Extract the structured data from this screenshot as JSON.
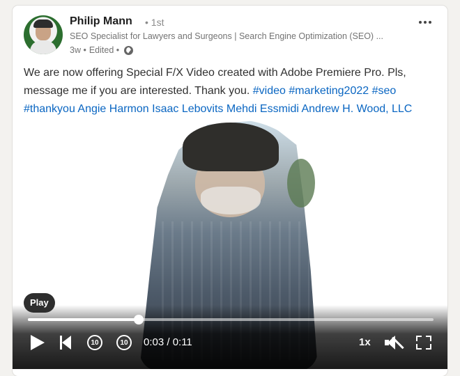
{
  "author": {
    "name": "Philip Mann",
    "degree": "• 1st",
    "headline": "SEO Specialist for Lawyers and Surgeons | Search Engine Optimization (SEO) ...",
    "time": "3w •",
    "edited": "Edited •",
    "avatar_icon": "profile-photo",
    "visibility_icon": "globe-icon"
  },
  "post": {
    "text_intro": "We are now offering Special F/X Video created with Adobe Premiere Pro. Pls, message me if you are interested. Thank you.",
    "hashtags": [
      "#video",
      "#marketing2022",
      "#seo",
      "#thankyou"
    ],
    "mentions": [
      "Angie Harmon",
      "Isaac Lebovits",
      "Mehdi Essmidi",
      "Andrew H. Wood, LLC"
    ]
  },
  "video": {
    "tooltip": "Play",
    "current_time": "0:03",
    "separator": "/",
    "duration": "0:11",
    "time_display": "0:03 / 0:11",
    "progress_fraction": 0.273,
    "speed": "1x",
    "skip_back_label": "10",
    "skip_forward_label": "10",
    "muted": true
  },
  "colors": {
    "link": "#0a66c2",
    "text": "#303030",
    "muted_text": "#737373",
    "background": "#f3f2ef"
  }
}
